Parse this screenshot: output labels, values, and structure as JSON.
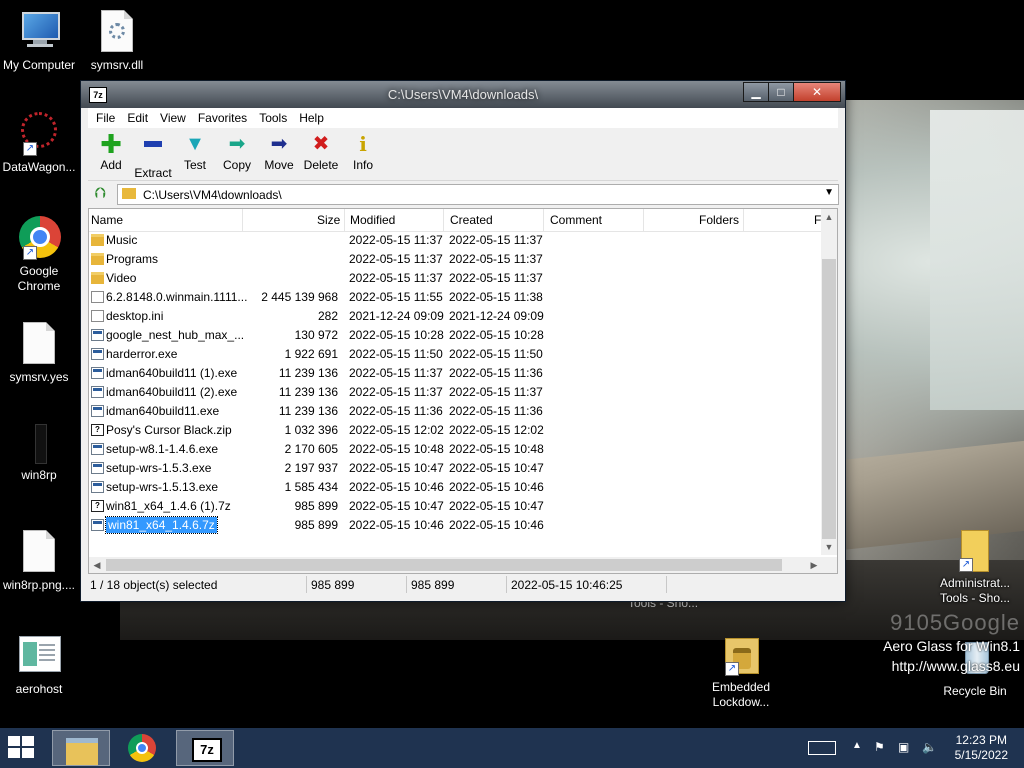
{
  "desktop": {
    "icons": [
      {
        "label": "My Computer"
      },
      {
        "label": "symsrv.dll"
      },
      {
        "label": "DataWagon..."
      },
      {
        "label": "Google Chrome"
      },
      {
        "label": "symsrv.yes"
      },
      {
        "label": "win8rp"
      },
      {
        "label": "win8rp.png...."
      },
      {
        "label": "aerohost"
      },
      {
        "label": "Embedded Lockdow..."
      },
      {
        "label": "Administrat... Tools - Sho..."
      },
      {
        "label": "Recycle Bin"
      }
    ],
    "watermark": "9105Google",
    "brand_line1": "Aero Glass for Win8.1",
    "brand_line2": "http://www.glass8.eu",
    "behind_text": "Tools - Sho..."
  },
  "window": {
    "title": "C:\\Users\\VM4\\downloads\\",
    "app_icon": "7z",
    "menu": [
      "File",
      "Edit",
      "View",
      "Favorites",
      "Tools",
      "Help"
    ],
    "toolbar": [
      {
        "label": "Add",
        "icon": "plus-icon",
        "color": "#1fa31f"
      },
      {
        "label": "Extract",
        "icon": "minus-icon",
        "color": "#1f3fb0"
      },
      {
        "label": "Test",
        "icon": "check-icon",
        "color": "#1aa6b7"
      },
      {
        "label": "Copy",
        "icon": "copy-arrow-icon",
        "color": "#1aa68a"
      },
      {
        "label": "Move",
        "icon": "move-arrow-icon",
        "color": "#1f2f8f"
      },
      {
        "label": "Delete",
        "icon": "delete-x-icon",
        "color": "#d11d1d"
      },
      {
        "label": "Info",
        "icon": "info-icon",
        "color": "#c9a400"
      }
    ],
    "address": "C:\\Users\\VM4\\downloads\\",
    "columns": [
      "Name",
      "Size",
      "Modified",
      "Created",
      "Comment",
      "Folders",
      "F"
    ],
    "files": [
      {
        "name": "Music",
        "size": "",
        "modified": "2022-05-15 11:37",
        "created": "2022-05-15 11:37",
        "type": "folder"
      },
      {
        "name": "Programs",
        "size": "",
        "modified": "2022-05-15 11:37",
        "created": "2022-05-15 11:37",
        "type": "folder"
      },
      {
        "name": "Video",
        "size": "",
        "modified": "2022-05-15 11:37",
        "created": "2022-05-15 11:37",
        "type": "folder"
      },
      {
        "name": "6.2.8148.0.winmain.1111...",
        "size": "2 445 139 968",
        "modified": "2022-05-15 11:55",
        "created": "2022-05-15 11:38",
        "type": "file"
      },
      {
        "name": "desktop.ini",
        "size": "282",
        "modified": "2021-12-24 09:09",
        "created": "2021-12-24 09:09",
        "type": "file"
      },
      {
        "name": "google_nest_hub_max_...",
        "size": "130 972",
        "modified": "2022-05-15 10:28",
        "created": "2022-05-15 10:28",
        "type": "exe"
      },
      {
        "name": "harderror.exe",
        "size": "1 922 691",
        "modified": "2022-05-15 11:50",
        "created": "2022-05-15 11:50",
        "type": "exe"
      },
      {
        "name": "idman640build11 (1).exe",
        "size": "11 239 136",
        "modified": "2022-05-15 11:37",
        "created": "2022-05-15 11:36",
        "type": "exe"
      },
      {
        "name": "idman640build11 (2).exe",
        "size": "11 239 136",
        "modified": "2022-05-15 11:37",
        "created": "2022-05-15 11:37",
        "type": "exe"
      },
      {
        "name": "idman640build11.exe",
        "size": "11 239 136",
        "modified": "2022-05-15 11:36",
        "created": "2022-05-15 11:36",
        "type": "exe"
      },
      {
        "name": "Posy's Cursor Black.zip",
        "size": "1 032 396",
        "modified": "2022-05-15 12:02",
        "created": "2022-05-15 12:02",
        "type": "zip"
      },
      {
        "name": "setup-w8.1-1.4.6.exe",
        "size": "2 170 605",
        "modified": "2022-05-15 10:48",
        "created": "2022-05-15 10:48",
        "type": "exe"
      },
      {
        "name": "setup-wrs-1.5.3.exe",
        "size": "2 197 937",
        "modified": "2022-05-15 10:47",
        "created": "2022-05-15 10:47",
        "type": "exe"
      },
      {
        "name": "setup-wrs-1.5.13.exe",
        "size": "1 585 434",
        "modified": "2022-05-15 10:46",
        "created": "2022-05-15 10:46",
        "type": "exe"
      },
      {
        "name": "win81_x64_1.4.6 (1).7z",
        "size": "985 899",
        "modified": "2022-05-15 10:47",
        "created": "2022-05-15 10:47",
        "type": "zip"
      },
      {
        "name": "win81_x64_1.4.6.7z",
        "size": "985 899",
        "modified": "2022-05-15 10:46",
        "created": "2022-05-15 10:46",
        "type": "exe",
        "selected": true
      }
    ],
    "status": {
      "selected": "1 / 18 object(s) selected",
      "size": "985 899",
      "packed": "985 899",
      "date": "2022-05-15 10:46:25"
    }
  },
  "taskbar": {
    "time": "12:23 PM",
    "date": "5/15/2022",
    "app_7z": "7z"
  }
}
